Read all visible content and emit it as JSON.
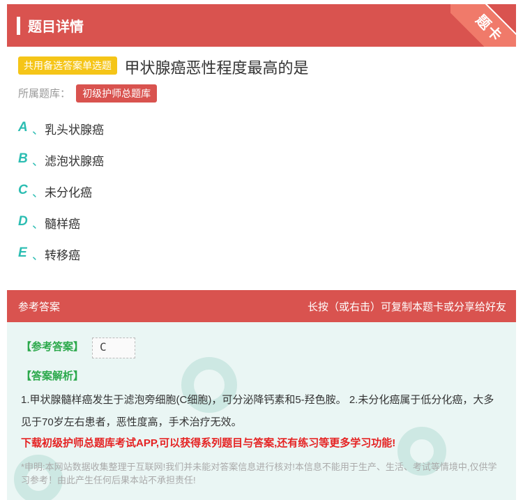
{
  "header": {
    "title": "题目详情",
    "corner_label": "题卡"
  },
  "question": {
    "type_badge": "共用备选答案单选题",
    "text": "甲状腺癌恶性程度最高的是"
  },
  "bank": {
    "label": "所属题库：",
    "name": "初级护师总题库"
  },
  "options": [
    {
      "letter": "A",
      "sep": "、",
      "text": "乳头状腺癌"
    },
    {
      "letter": "B",
      "sep": "、",
      "text": "滤泡状腺癌"
    },
    {
      "letter": "C",
      "sep": "、",
      "text": "未分化癌"
    },
    {
      "letter": "D",
      "sep": "、",
      "text": "髓样癌"
    },
    {
      "letter": "E",
      "sep": "、",
      "text": "转移癌"
    }
  ],
  "answer_section": {
    "title": "参考答案",
    "hint": "长按（或右击）可复制本题卡或分享给好友",
    "reference_label": "【参考答案】",
    "reference_value": "C",
    "analysis_label": "【答案解析】",
    "analysis_text": "1.甲状腺髓样癌发生于滤泡旁细胞(C细胞)，可分泌降钙素和5-羟色胺。 2.未分化癌属于低分化癌，大多见于70岁左右患者，恶性度高，手术治疗无效。",
    "promo": "下载初级护师总题库考试APP,可以获得系列题目与答案,还有练习等更多学习功能!",
    "disclaimer": "*申明:本网站数据收集整理于互联网!我们并未能对答案信息进行核对!本信息不能用于生产、生活、考试等情境中,仅供学习参考！由此产生任何后果本站不承担责任!"
  },
  "colors": {
    "header_red": "#d9534f",
    "badge_yellow": "#f5c518",
    "option_teal": "#2bbdb2",
    "answer_green": "#2aa84a",
    "promo_red": "#e52222",
    "answer_bg": "#eaf6f4"
  }
}
